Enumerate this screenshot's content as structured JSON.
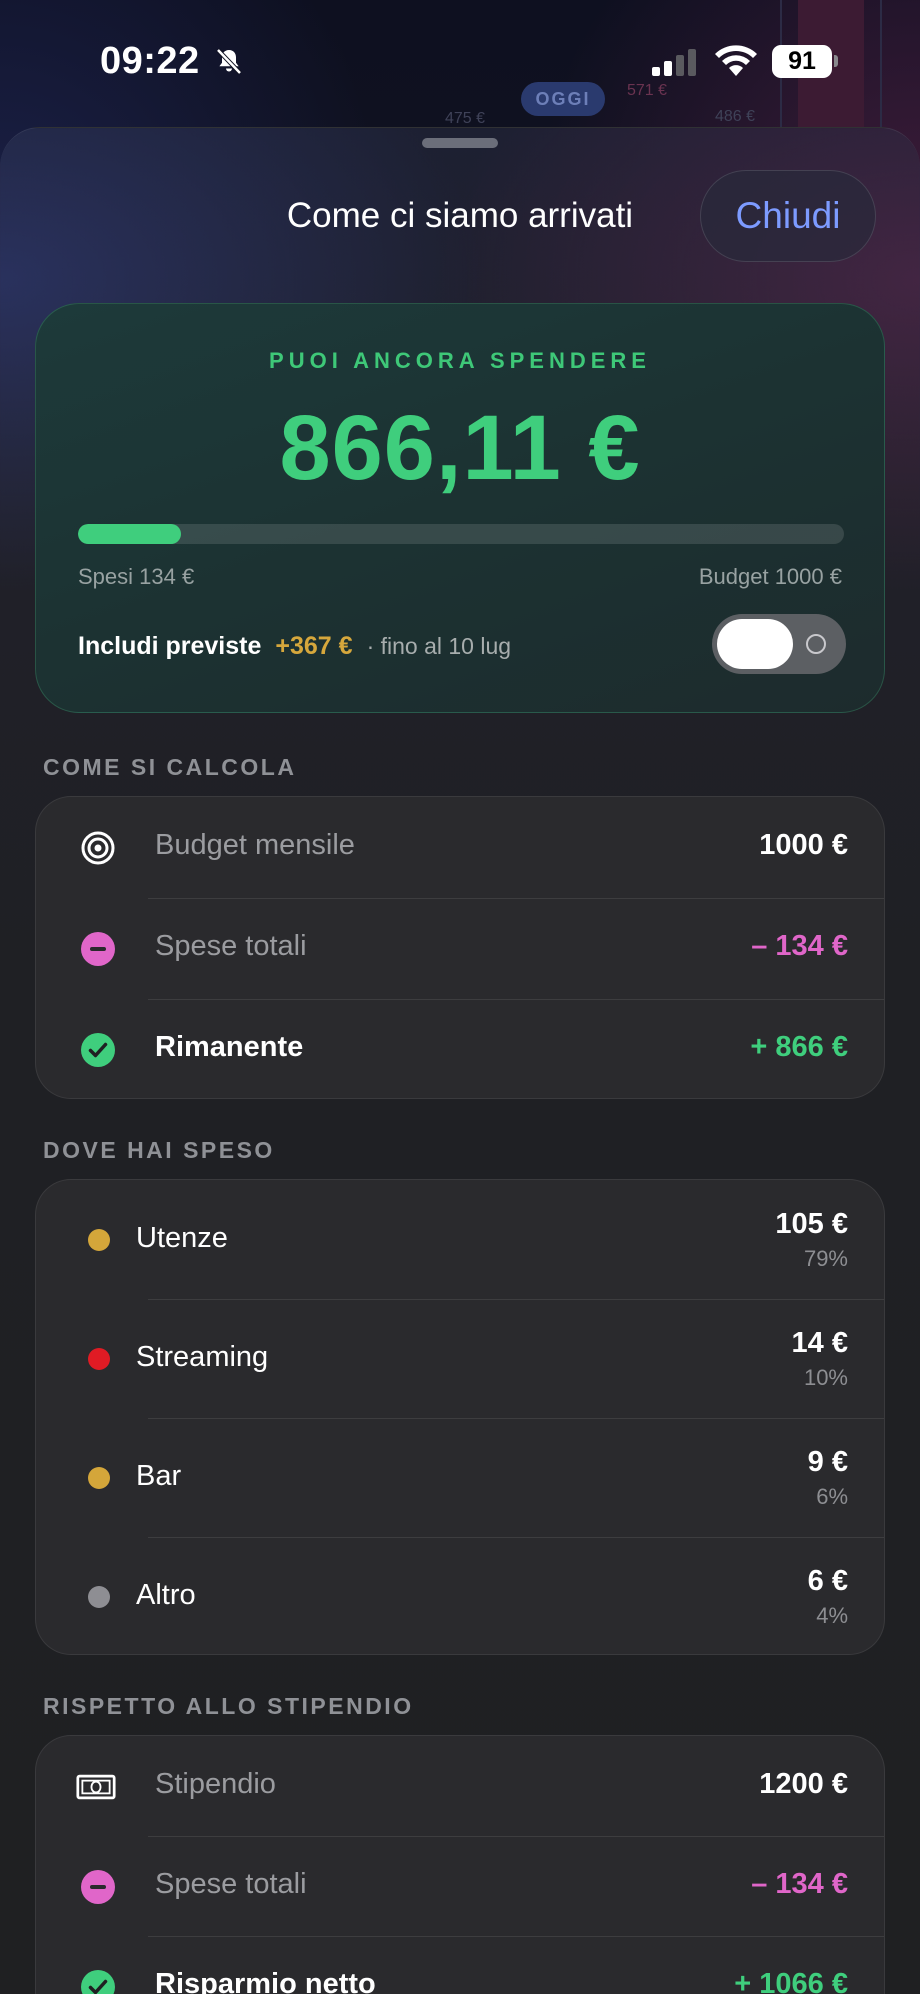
{
  "status_bar": {
    "time": "09:22",
    "battery": "91"
  },
  "background_chart": {
    "today_label": "OGGI",
    "labels": [
      "475 €",
      "571 €",
      "486 €"
    ]
  },
  "sheet": {
    "title": "Come ci siamo arrivati",
    "close_label": "Chiudi"
  },
  "hero": {
    "eyebrow": "PUOI ANCORA SPENDERE",
    "amount": "866,11 €",
    "progress_fraction": 0.134,
    "spent_label": "Spesi 134 €",
    "budget_label": "Budget 1000 €",
    "include_label": "Includi previste",
    "include_value": "+367 €",
    "include_until": "· fino al 10 lug",
    "toggle_on": false,
    "accent_color": "#3fce7d"
  },
  "calc": {
    "section_label": "COME SI CALCOLA",
    "rows": [
      {
        "icon": "target-icon",
        "label": "Budget mensile",
        "value": "1000 €"
      },
      {
        "icon": "minus-circle-icon",
        "label": "Spese totali",
        "value": "– 134 €"
      },
      {
        "icon": "check-circle-icon",
        "label": "Rimanente",
        "value": "+ 866 €"
      }
    ]
  },
  "spend": {
    "section_label": "DOVE HAI SPESO",
    "rows": [
      {
        "label": "Utenze",
        "value": "105 €",
        "pct": "79%",
        "color": "#d4a63a"
      },
      {
        "label": "Streaming",
        "value": "14 €",
        "pct": "10%",
        "color": "#e01b24"
      },
      {
        "label": "Bar",
        "value": "9 €",
        "pct": "6%",
        "color": "#d4a63a"
      },
      {
        "label": "Altro",
        "value": "6 €",
        "pct": "4%",
        "color": "#8e8e93"
      }
    ]
  },
  "salary": {
    "section_label": "RISPETTO ALLO STIPENDIO",
    "rows": [
      {
        "icon": "banknote-icon",
        "label": "Stipendio",
        "value": "1200 €"
      },
      {
        "icon": "minus-circle-icon",
        "label": "Spese totali",
        "value": "– 134 €"
      },
      {
        "icon": "check-circle-icon",
        "label": "Risparmio netto",
        "value": "+ 1066 €"
      }
    ]
  }
}
